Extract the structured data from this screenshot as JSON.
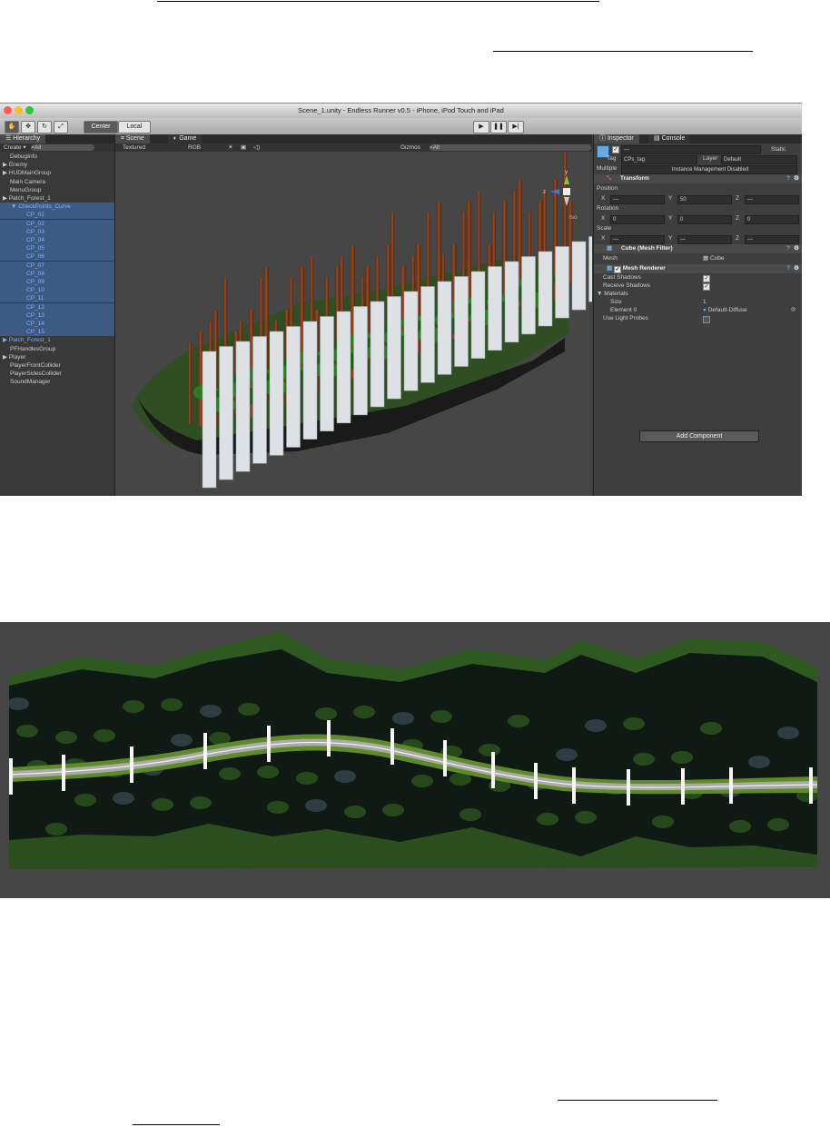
{
  "window": {
    "title": "Scene_1.unity - Endless Runner v0.5 - iPhone, iPod Touch and iPad",
    "colors": {
      "red": "#fd5f56",
      "yellow": "#fdbd2d",
      "green": "#2bc740"
    }
  },
  "toolbar": {
    "tools": [
      "hand-icon",
      "move-icon",
      "rotate-icon",
      "scale-icon"
    ],
    "pivot_center": "Center",
    "pivot_local": "Local"
  },
  "hierarchy": {
    "tab": "Hierarchy",
    "create": "Create",
    "search_placeholder": "All",
    "items": [
      {
        "label": "DebugInfo",
        "indent": 0,
        "arrow": false,
        "selected": false,
        "blue": false
      },
      {
        "label": "Enemy",
        "indent": 0,
        "arrow": true,
        "selected": false,
        "blue": false
      },
      {
        "label": "HUDMainGroup",
        "indent": 0,
        "arrow": true,
        "selected": false,
        "blue": false
      },
      {
        "label": "Main Camera",
        "indent": 0,
        "arrow": false,
        "selected": false,
        "blue": false
      },
      {
        "label": "MenuGroup",
        "indent": 0,
        "arrow": false,
        "selected": false,
        "blue": false
      },
      {
        "label": "Patch_Forest_1",
        "indent": 0,
        "arrow": true,
        "selected": false,
        "blue": false
      },
      {
        "label": "CheckPoints_Curve",
        "indent": 1,
        "arrow": true,
        "selected": true,
        "blue": true
      },
      {
        "label": "CP_01",
        "indent": 2,
        "arrow": false,
        "selected": true,
        "blue": true
      },
      {
        "label": "CP_02",
        "indent": 2,
        "arrow": false,
        "selected": true,
        "blue": true
      },
      {
        "label": "CP_03",
        "indent": 2,
        "arrow": false,
        "selected": true,
        "blue": true
      },
      {
        "label": "CP_04",
        "indent": 2,
        "arrow": false,
        "selected": true,
        "blue": true
      },
      {
        "label": "CP_05",
        "indent": 2,
        "arrow": false,
        "selected": true,
        "blue": true
      },
      {
        "label": "CP_06",
        "indent": 2,
        "arrow": false,
        "selected": true,
        "blue": true
      },
      {
        "label": "CP_07",
        "indent": 2,
        "arrow": false,
        "selected": true,
        "blue": true
      },
      {
        "label": "CP_08",
        "indent": 2,
        "arrow": false,
        "selected": true,
        "blue": true
      },
      {
        "label": "CP_09",
        "indent": 2,
        "arrow": false,
        "selected": true,
        "blue": true
      },
      {
        "label": "CP_10",
        "indent": 2,
        "arrow": false,
        "selected": true,
        "blue": true
      },
      {
        "label": "CP_11",
        "indent": 2,
        "arrow": false,
        "selected": true,
        "blue": true
      },
      {
        "label": "CP_12",
        "indent": 2,
        "arrow": false,
        "selected": true,
        "blue": true
      },
      {
        "label": "CP_13",
        "indent": 2,
        "arrow": false,
        "selected": true,
        "blue": true
      },
      {
        "label": "CP_14",
        "indent": 2,
        "arrow": false,
        "selected": true,
        "blue": true
      },
      {
        "label": "CP_15",
        "indent": 2,
        "arrow": false,
        "selected": true,
        "blue": true
      },
      {
        "label": "Patch_Forest_1",
        "indent": 0,
        "arrow": true,
        "selected": false,
        "blue": true
      },
      {
        "label": "PFHandlesGroup",
        "indent": 0,
        "arrow": false,
        "selected": false,
        "blue": false
      },
      {
        "label": "Player",
        "indent": 0,
        "arrow": true,
        "selected": false,
        "blue": false
      },
      {
        "label": "PlayerFrontCollider",
        "indent": 0,
        "arrow": false,
        "selected": false,
        "blue": false
      },
      {
        "label": "PlayerSidesCollider",
        "indent": 0,
        "arrow": false,
        "selected": false,
        "blue": false
      },
      {
        "label": "SoundManager",
        "indent": 0,
        "arrow": false,
        "selected": false,
        "blue": false
      }
    ]
  },
  "scene": {
    "tab_scene": "Scene",
    "tab_game": "Game",
    "render_mode": "Textured",
    "color_mode": "RGB",
    "gizmos": "Gizmos",
    "search_placeholder": "All",
    "gizmo_axis_y": "y",
    "gizmo_axis_z": "z",
    "projection": "Iso"
  },
  "inspector": {
    "tab_inspector": "Inspector",
    "tab_console": "Console",
    "static_label": "Static",
    "tag_label": "Tag",
    "tag_value": "CPs_tag",
    "layer_label": "Layer",
    "layer_value": "Default",
    "multiple_label": "Multiple",
    "multiple_value": "Instance Management Disabled",
    "transform": {
      "title": "Transform",
      "position_label": "Position",
      "rotation_label": "Rotation",
      "scale_label": "Scale",
      "x": "X",
      "y": "Y",
      "z": "Z",
      "pos": [
        "—",
        "50",
        "—"
      ],
      "rot": [
        "0",
        "0",
        "0"
      ],
      "scl": [
        "—",
        "—",
        "—"
      ]
    },
    "mesh_filter": {
      "title": "Cube (Mesh Filter)",
      "mesh_label": "Mesh",
      "mesh_value": "Cube"
    },
    "mesh_renderer": {
      "title": "Mesh Renderer",
      "cast_shadows": "Cast Shadows",
      "receive_shadows": "Receive Shadows",
      "materials": "Materials",
      "size_label": "Size",
      "size_value": "1",
      "element0_label": "Element 0",
      "element0_value": "Default-Diffuse",
      "light_probes": "Use Light Probes"
    },
    "add_component": "Add Component"
  }
}
